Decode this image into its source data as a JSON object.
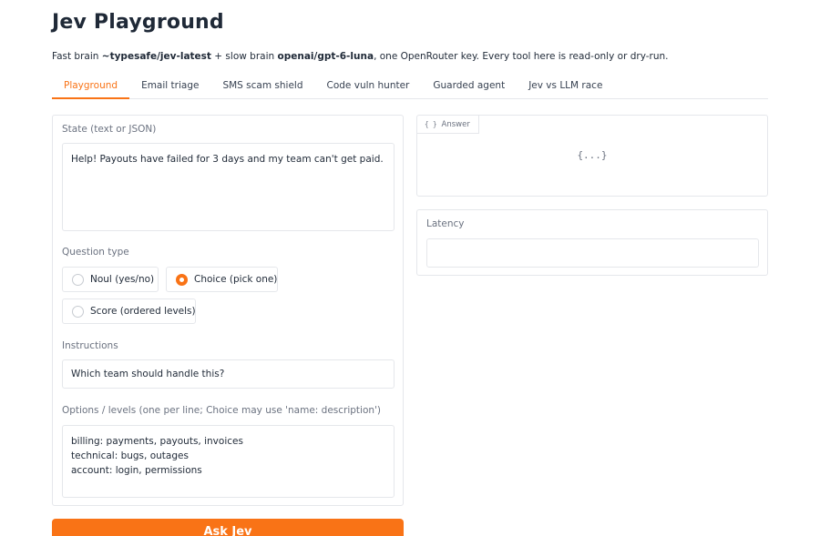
{
  "header": {
    "title": "Jev Playground",
    "subtitle": {
      "p1": "Fast brain ",
      "fast_model": "~typesafe/jev-latest",
      "p2": " + slow brain ",
      "slow_model": "openai/gpt-6-luna",
      "p3": ", one OpenRouter key. Every tool here is read-only or dry-run."
    }
  },
  "tabs": [
    {
      "label": "Playground",
      "active": true
    },
    {
      "label": "Email triage",
      "active": false
    },
    {
      "label": "SMS scam shield",
      "active": false
    },
    {
      "label": "Code vuln hunter",
      "active": false
    },
    {
      "label": "Guarded agent",
      "active": false
    },
    {
      "label": "Jev vs LLM race",
      "active": false
    }
  ],
  "form": {
    "state_label": "State (text or JSON)",
    "state_value": "Help! Payouts have failed for 3 days and my team can't get paid.",
    "question_type_label": "Question type",
    "question_types": [
      {
        "label": "Noul (yes/no)",
        "checked": false
      },
      {
        "label": "Choice (pick one)",
        "checked": true
      },
      {
        "label": "Score (ordered levels)",
        "checked": false
      }
    ],
    "instructions_label": "Instructions",
    "instructions_value": "Which team should handle this?",
    "options_label": "Options / levels (one per line; Choice may use 'name: description')",
    "options_value": "billing: payments, payouts, invoices\ntechnical: bugs, outages\naccount: login, permissions",
    "ask_button": "Ask Jev"
  },
  "output": {
    "answer_label": "Answer",
    "answer_icon": "{ }",
    "answer_value": "{...}",
    "latency_label": "Latency",
    "latency_value": ""
  },
  "colors": {
    "accent": "#f97316",
    "border": "#e5e7eb",
    "muted_text": "#6b7280"
  }
}
